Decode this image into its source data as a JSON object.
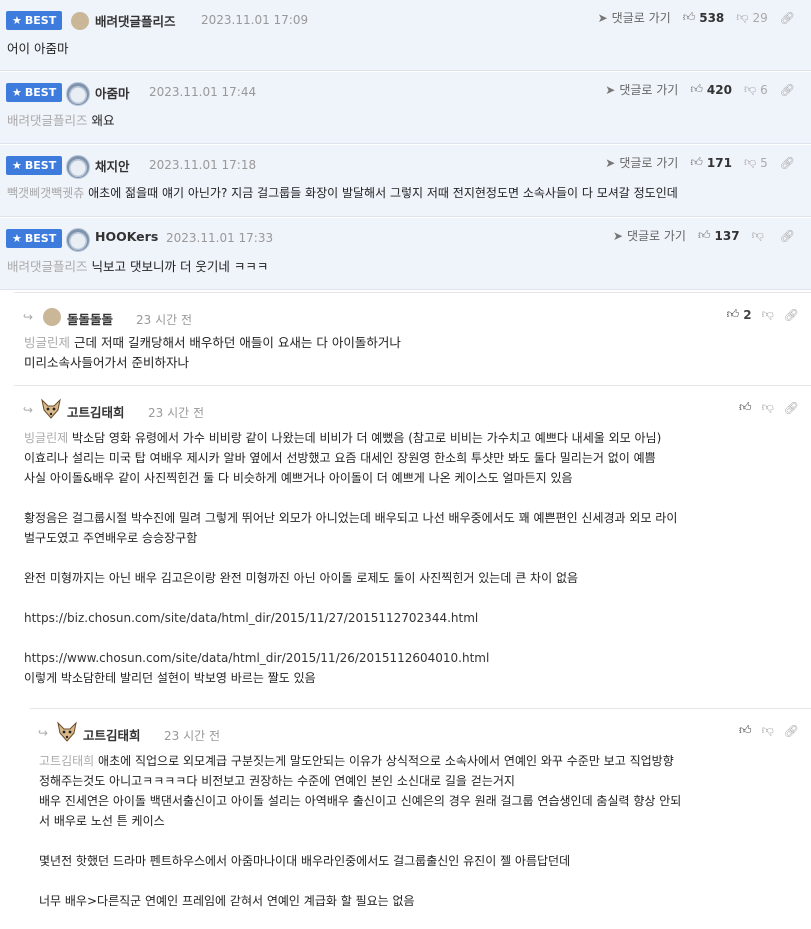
{
  "best_label": "BEST",
  "goto_label": "댓글로 가기",
  "best_comments": [
    {
      "nick": "배려댓글플리즈",
      "date": "2023.11.01 17:09",
      "up": "538",
      "down": "29",
      "mention": "",
      "text": "어이 아줌마"
    },
    {
      "nick": "아줌마",
      "date": "2023.11.01 17:44",
      "up": "420",
      "down": "6",
      "mention": "배려댓글플리즈",
      "text": "왜요"
    },
    {
      "nick": "채지안",
      "date": "2023.11.01 17:18",
      "up": "171",
      "down": "5",
      "mention": "빽갯삐갯빽궷츄",
      "text": "애초에 젊을때 얘기 아닌가? 지금 걸그룹들 화장이 발달해서 그렇지 저때 전지현정도면 소속사들이 다 모셔갈 정도인데"
    },
    {
      "nick": "HOOKers",
      "date": "2023.11.01 17:33",
      "up": "137",
      "down": "",
      "mention": "배려댓글플리즈",
      "text": "닉보고 댓보니까 더 웃기네 ㅋㅋㅋ"
    }
  ],
  "replies": [
    {
      "nick": "돌돌돌돌",
      "date": "23 시간 전",
      "up": "2",
      "lines": [
        {
          "mention": "빙글린제",
          "text": "근데 저때 길캐당해서 배우하던 애들이 요새는 다 아이돌하거나"
        },
        {
          "mention": "",
          "text": "미리소속사들어가서 준비하자나"
        }
      ]
    },
    {
      "nick": "고트김태희",
      "date": "23 시간 전",
      "up": "",
      "lines": [
        {
          "mention": "빙글린제",
          "text": "박소담 영화 유령에서 가수 비비랑 같이 나왔는데 비비가 더 예뻤음 (참고로 비비는 가수치고 예쁘다 내세울 외모 아님)"
        },
        {
          "mention": "",
          "text": "이효리나 설리는 미국 탑 여배우 제시카 알바 옆에서 선방했고 요즘 대세인 장원영 한소희 투샷만 봐도 둘다 밀리는거 없이 예쁨"
        },
        {
          "mention": "",
          "text": "사실 아이돌&배우 같이 사진찍힌건 둘 다 비슷하게 예쁘거나 아이돌이 더 예쁘게 나온 케이스도 얼마든지 있음"
        },
        {
          "mention": "",
          "text": ""
        },
        {
          "mention": "",
          "text": "황정음은 걸그룹시절 박수진에 밀려 그렇게 뛰어난 외모가 아니었는데 배우되고 나선 배우중에서도 꽤 예쁜편인 신세경과 외모 라이"
        },
        {
          "mention": "",
          "text": "벌구도였고 주연배우로 승승장구함"
        },
        {
          "mention": "",
          "text": ""
        },
        {
          "mention": "",
          "text": "완전 미형까지는 아닌 배우 김고은이랑 완전 미형까진 아닌 아이돌 로제도 둘이 사진찍힌거 있는데 큰 차이 없음"
        },
        {
          "mention": "",
          "text": ""
        },
        {
          "mention": "",
          "text": "https://biz.chosun.com/site/data/html_dir/2015/11/27/2015112702344.html"
        },
        {
          "mention": "",
          "text": ""
        },
        {
          "mention": "",
          "text": "https://www.chosun.com/site/data/html_dir/2015/11/26/2015112604010.html"
        },
        {
          "mention": "",
          "text": "이렇게 박소담한테 발리던 설현이 박보영 바르는 짤도 있음"
        }
      ]
    },
    {
      "nick": "고트김태희",
      "date": "23 시간 전",
      "up": "",
      "lines": [
        {
          "mention": "고트김태희",
          "text": "애초에 직업으로 외모계급 구분짓는게 말도안되는 이유가 상식적으로 소속사에서 연예인 와꾸 수준만 보고 직업방향"
        },
        {
          "mention": "",
          "text": "정해주는것도 아니고ㅋㅋㅋㅋ다 비전보고 권장하는 수준에 연예인 본인 소신대로 길을 걷는거지"
        },
        {
          "mention": "",
          "text": "배우 진세연은 아이돌 백댄서출신이고 아이돌 설리는 아역배우 출신이고 신예은의 경우 원래 걸그룹 연습생인데 춤실력 향상 안되"
        },
        {
          "mention": "",
          "text": "서 배우로 노선 튼 케이스"
        },
        {
          "mention": "",
          "text": ""
        },
        {
          "mention": "",
          "text": "몇년전 핫했던 드라마 펜트하우스에서 아줌마나이대 배우라인중에서도 걸그룹출신인 유진이 젤 아름답던데"
        },
        {
          "mention": "",
          "text": ""
        },
        {
          "mention": "",
          "text": "너무 배우>다른직군 연예인 프레임에 갇혀서 연예인 계급화 할 필요는 없음"
        }
      ]
    }
  ]
}
